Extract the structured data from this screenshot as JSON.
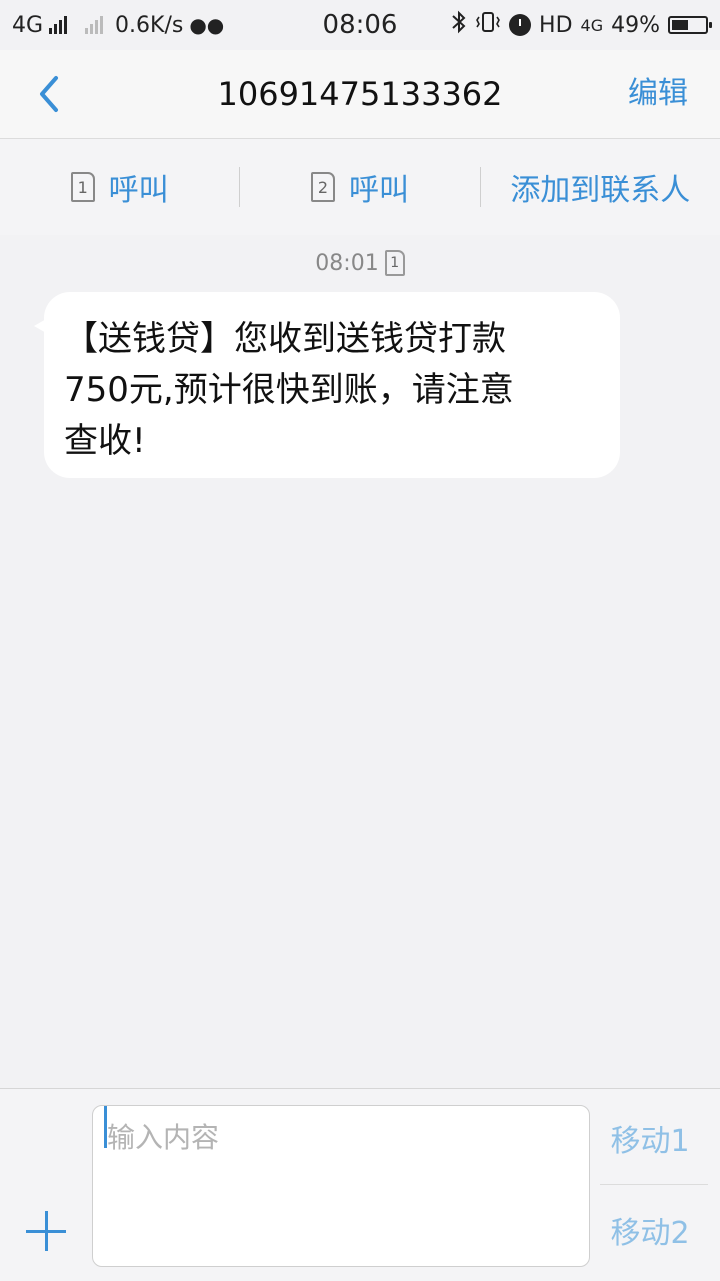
{
  "status_bar": {
    "network1": "4G",
    "speed": "0.6K/s",
    "time": "08:06",
    "hd": "HD",
    "network2": "4G",
    "battery_percent": "49%",
    "battery_level": 0.49,
    "icons": [
      "wechat-icon",
      "bluetooth-icon",
      "vibrate-icon",
      "alarm-icon",
      "battery-icon"
    ]
  },
  "header": {
    "title": "10691475133362",
    "edit_label": "编辑"
  },
  "actions": {
    "call1_label": "呼叫",
    "call1_sim": "1",
    "call2_label": "呼叫",
    "call2_sim": "2",
    "add_contact_label": "添加到联系人"
  },
  "conversation": {
    "timestamp": "08:01",
    "timestamp_sim": "1",
    "message_lines": [
      "【送钱贷】您收到送钱贷打款",
      "750元,预计很快到账，请注意",
      "查收!"
    ]
  },
  "composer": {
    "placeholder": "输入内容",
    "send1_label": "移动1",
    "send2_label": "移动2"
  },
  "colors": {
    "accent": "#3a8fd6",
    "background": "#f2f2f4",
    "bubble": "#ffffff"
  }
}
